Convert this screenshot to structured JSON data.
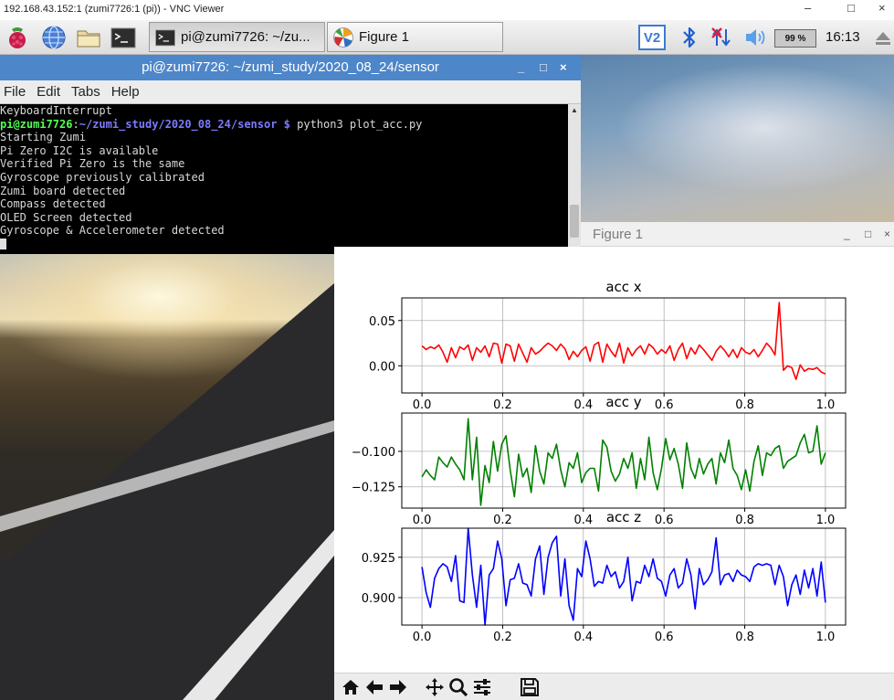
{
  "vnc": {
    "title": "192.168.43.152:1 (zumi7726:1 (pi)) - VNC Viewer",
    "minimize": "–",
    "restore": "□",
    "close": "×"
  },
  "taskbar": {
    "launchers": [
      "raspberry-menu-icon",
      "web-browser-icon",
      "file-manager-icon",
      "terminal-icon"
    ],
    "tasks": [
      {
        "label": "pi@zumi7726: ~/zu...",
        "icon": "terminal-icon"
      },
      {
        "label": "Figure 1",
        "icon": "figure-icon"
      }
    ],
    "tray": {
      "vnc": "V2",
      "cpu": "99 %",
      "clock": "16:13"
    }
  },
  "terminal": {
    "title": "pi@zumi7726: ~/zumi_study/2020_08_24/sensor",
    "buttons": {
      "minimize": "_",
      "maximize": "□",
      "close": "×"
    },
    "menu": [
      "File",
      "Edit",
      "Tabs",
      "Help"
    ],
    "prompt_user": "pi@zumi7726",
    "prompt_path": "~/zumi_study/2020_08_24/sensor $",
    "command": " python3 plot_acc.py",
    "lines_before": [
      "KeyboardInterrupt"
    ],
    "lines_after": [
      "Starting Zumi",
      "Pi Zero I2C is available",
      "Verified Pi Zero is the same",
      "Gyroscope previously calibrated",
      "Zumi board detected",
      "Compass detected",
      "OLED Screen detected",
      "Gyroscope & Accelerometer detected"
    ]
  },
  "figure": {
    "title": "Figure 1",
    "buttons": {
      "minimize": "_",
      "maximize": "□",
      "close": "×"
    },
    "toolbar": [
      "home-icon",
      "back-arrow-icon",
      "forward-arrow-icon",
      "pan-icon",
      "zoom-icon",
      "subplots-config-icon",
      "save-icon"
    ]
  },
  "chart_data": [
    {
      "type": "line",
      "title": "acc x",
      "color": "#ff0000",
      "xlim": [
        -0.05,
        1.05
      ],
      "ylim": [
        -0.03,
        0.075
      ],
      "xticks": [
        0.0,
        0.2,
        0.4,
        0.6,
        0.8,
        1.0
      ],
      "xticklabels": [
        "0.0",
        "0.2",
        "0.4",
        "0.6",
        "0.8",
        "1.0"
      ],
      "yticks": [
        0.0,
        0.05
      ],
      "yticklabels": [
        "0.00",
        "0.05"
      ],
      "grid": true,
      "y": [
        0.022,
        0.018,
        0.021,
        0.019,
        0.023,
        0.015,
        0.004,
        0.02,
        0.009,
        0.021,
        0.018,
        0.023,
        0.006,
        0.02,
        0.015,
        0.022,
        0.01,
        0.025,
        0.024,
        0.003,
        0.024,
        0.022,
        0.005,
        0.024,
        0.014,
        0.004,
        0.02,
        0.013,
        0.016,
        0.021,
        0.025,
        0.022,
        0.017,
        0.024,
        0.019,
        0.007,
        0.016,
        0.01,
        0.017,
        0.021,
        0.005,
        0.023,
        0.026,
        0.004,
        0.024,
        0.016,
        0.01,
        0.025,
        0.003,
        0.02,
        0.011,
        0.018,
        0.022,
        0.013,
        0.024,
        0.02,
        0.013,
        0.018,
        0.014,
        0.022,
        0.006,
        0.018,
        0.025,
        0.008,
        0.02,
        0.013,
        0.023,
        0.018,
        0.012,
        0.006,
        0.016,
        0.022,
        0.017,
        0.01,
        0.018,
        0.009,
        0.02,
        0.015,
        0.013,
        0.018,
        0.01,
        0.017,
        0.025,
        0.02,
        0.012,
        0.07,
        -0.005,
        0.0,
        -0.002,
        -0.015,
        0.001,
        -0.006,
        -0.003,
        -0.004,
        -0.002,
        -0.007,
        -0.009
      ]
    },
    {
      "type": "line",
      "title": "acc y",
      "color": "#008000",
      "xlim": [
        -0.05,
        1.05
      ],
      "ylim": [
        -0.14,
        -0.073
      ],
      "xticks": [
        0.0,
        0.2,
        0.4,
        0.6,
        0.8,
        1.0
      ],
      "xticklabels": [
        "0.0",
        "0.2",
        "0.4",
        "0.6",
        "0.8",
        "1.0"
      ],
      "yticks": [
        -0.125,
        -0.1
      ],
      "yticklabels": [
        "−0.125",
        "−0.100"
      ],
      "grid": true,
      "y": [
        -0.118,
        -0.113,
        -0.117,
        -0.12,
        -0.104,
        -0.108,
        -0.111,
        -0.104,
        -0.109,
        -0.113,
        -0.12,
        -0.077,
        -0.12,
        -0.09,
        -0.138,
        -0.11,
        -0.122,
        -0.093,
        -0.114,
        -0.095,
        -0.089,
        -0.113,
        -0.132,
        -0.102,
        -0.118,
        -0.112,
        -0.129,
        -0.096,
        -0.114,
        -0.123,
        -0.101,
        -0.105,
        -0.095,
        -0.113,
        -0.125,
        -0.108,
        -0.112,
        -0.101,
        -0.122,
        -0.115,
        -0.112,
        -0.112,
        -0.128,
        -0.092,
        -0.097,
        -0.114,
        -0.121,
        -0.116,
        -0.105,
        -0.112,
        -0.101,
        -0.126,
        -0.105,
        -0.12,
        -0.09,
        -0.115,
        -0.127,
        -0.112,
        -0.091,
        -0.106,
        -0.098,
        -0.109,
        -0.126,
        -0.094,
        -0.112,
        -0.119,
        -0.105,
        -0.116,
        -0.109,
        -0.105,
        -0.123,
        -0.101,
        -0.108,
        -0.092,
        -0.112,
        -0.117,
        -0.127,
        -0.113,
        -0.128,
        -0.107,
        -0.096,
        -0.117,
        -0.101,
        -0.103,
        -0.098,
        -0.096,
        -0.112,
        -0.107,
        -0.105,
        -0.103,
        -0.094,
        -0.088,
        -0.101,
        -0.1,
        -0.082,
        -0.109,
        -0.101
      ]
    },
    {
      "type": "line",
      "title": "acc z",
      "color": "#0000ff",
      "xlim": [
        -0.05,
        1.05
      ],
      "ylim": [
        0.883,
        0.943
      ],
      "xticks": [
        0.0,
        0.2,
        0.4,
        0.6,
        0.8,
        1.0
      ],
      "xticklabels": [
        "0.0",
        "0.2",
        "0.4",
        "0.6",
        "0.8",
        "1.0"
      ],
      "yticks": [
        0.9,
        0.925
      ],
      "yticklabels": [
        "0.900",
        "0.925"
      ],
      "grid": true,
      "y": [
        0.919,
        0.903,
        0.894,
        0.912,
        0.918,
        0.921,
        0.919,
        0.91,
        0.926,
        0.898,
        0.897,
        0.943,
        0.914,
        0.894,
        0.92,
        0.883,
        0.914,
        0.918,
        0.935,
        0.924,
        0.895,
        0.911,
        0.912,
        0.921,
        0.909,
        0.908,
        0.901,
        0.924,
        0.932,
        0.902,
        0.925,
        0.934,
        0.938,
        0.901,
        0.924,
        0.895,
        0.886,
        0.918,
        0.913,
        0.935,
        0.924,
        0.907,
        0.91,
        0.909,
        0.92,
        0.913,
        0.916,
        0.906,
        0.91,
        0.925,
        0.898,
        0.91,
        0.909,
        0.92,
        0.913,
        0.924,
        0.912,
        0.91,
        0.901,
        0.914,
        0.918,
        0.906,
        0.909,
        0.924,
        0.914,
        0.893,
        0.918,
        0.908,
        0.911,
        0.916,
        0.937,
        0.908,
        0.914,
        0.915,
        0.91,
        0.917,
        0.914,
        0.913,
        0.91,
        0.919,
        0.921,
        0.92,
        0.921,
        0.92,
        0.908,
        0.92,
        0.913,
        0.895,
        0.908,
        0.914,
        0.902,
        0.917,
        0.906,
        0.918,
        0.901,
        0.922,
        0.897
      ]
    }
  ]
}
